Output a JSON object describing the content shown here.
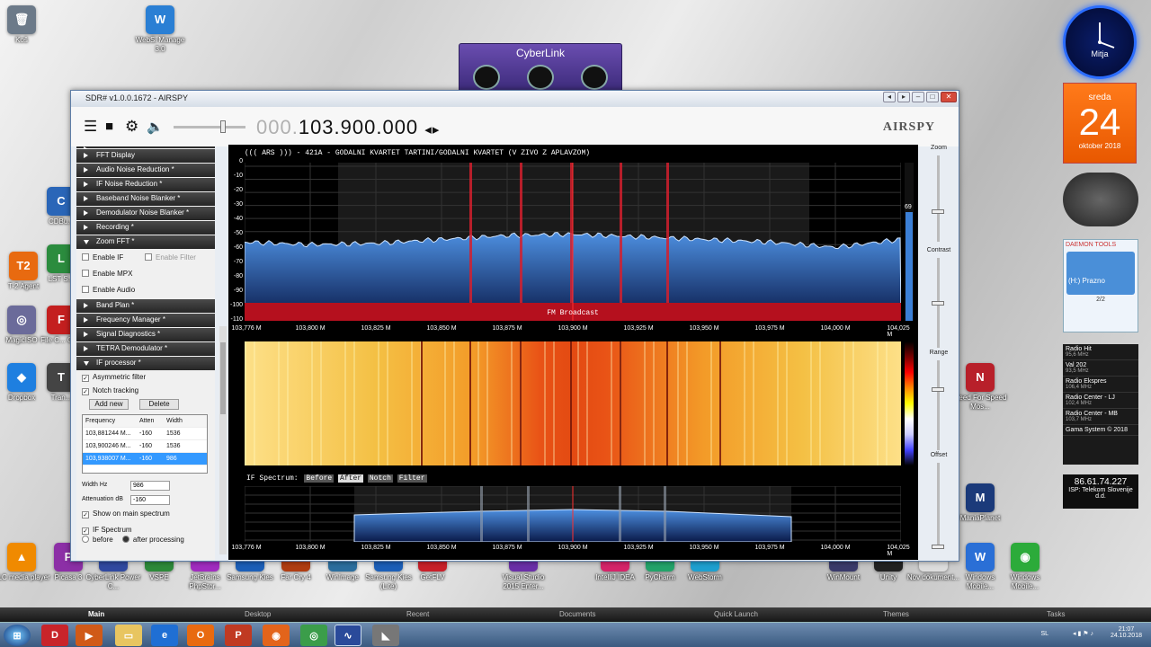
{
  "desktop": {
    "icons_left": [
      {
        "label": "Koš",
        "color": "#6c7a89",
        "glyph": "🗑"
      },
      {
        "label": "WebSi Manage 3.0",
        "color": "#2a7fd4",
        "glyph": "W"
      },
      {
        "label": "CDBu...",
        "color": "#2a66b8",
        "glyph": "C"
      },
      {
        "label": "T-2 Agent",
        "color": "#e86a10",
        "glyph": "T2"
      },
      {
        "label": "LST S...",
        "color": "#2b8c3e",
        "glyph": "L"
      },
      {
        "label": "MagicISO",
        "color": "#6b6b9a",
        "glyph": "◎"
      },
      {
        "label": "File C... Cli...",
        "color": "#c41f1f",
        "glyph": "F"
      },
      {
        "label": "Dropbox",
        "color": "#1e7fe0",
        "glyph": "◆"
      },
      {
        "label": "Tran...",
        "color": "#444",
        "glyph": "T"
      }
    ],
    "icons_bottom": [
      {
        "label": "VLC media player",
        "color": "#f08a00",
        "glyph": "▲"
      },
      {
        "label": "Picasa 3",
        "color": "#8c2fa6",
        "glyph": "P"
      },
      {
        "label": "CyberLink Power C...",
        "color": "#3049a0",
        "glyph": "C"
      },
      {
        "label": "VSPE",
        "color": "#2d8a3a",
        "glyph": "V"
      },
      {
        "label": "JetBrains PhpStor...",
        "color": "#a12cc0",
        "glyph": "J"
      },
      {
        "label": "Samsung Kies",
        "color": "#1c5fb8",
        "glyph": "S"
      },
      {
        "label": "Far Cry 4",
        "color": "#b03d12",
        "glyph": "F"
      },
      {
        "label": "WinImage",
        "color": "#2c6e9e",
        "glyph": "W"
      },
      {
        "label": "Samsung Kies (Lite)",
        "color": "#1c5fb8",
        "glyph": "S"
      },
      {
        "label": "GetFLV",
        "color": "#c9202a",
        "glyph": "G"
      },
      {
        "label": "Visual Studio 2015 Enter...",
        "color": "#6a2fa8",
        "glyph": "V"
      },
      {
        "label": "IntelliJ IDEA",
        "color": "#d6246a",
        "glyph": "I"
      },
      {
        "label": "PyCharm",
        "color": "#23a36a",
        "glyph": "P"
      },
      {
        "label": "WebStorm",
        "color": "#1ea0d0",
        "glyph": "W"
      },
      {
        "label": "WinMount",
        "color": "#3a3a6a",
        "glyph": "W"
      },
      {
        "label": "Unity",
        "color": "#222",
        "glyph": "U"
      },
      {
        "label": "Nov dokument...",
        "color": "#ddd",
        "glyph": "D"
      },
      {
        "label": "Windows Mobile...",
        "color": "#2a6fd6",
        "glyph": "W"
      },
      {
        "label": "Windows Mobile...",
        "color": "#2cab3a",
        "glyph": "◉"
      }
    ],
    "icons_right": [
      {
        "label": "Need For Speed Mos...",
        "color": "#b8202a",
        "glyph": "N"
      },
      {
        "label": "ManiaPlanet",
        "color": "#1b3a7a",
        "glyph": "M"
      }
    ],
    "cyberlink_title": "CyberLink",
    "clock_name": "Mitja",
    "calendar": {
      "day": "sreda",
      "date": "24",
      "month": "oktober 2018"
    },
    "daemon": {
      "brand": "DAEMON TOOLS",
      "drive": "(H:) Prazno",
      "count": "2/2"
    },
    "radio": [
      {
        "name": "Radio Hit",
        "freq": "95,6 MHz"
      },
      {
        "name": "Val 202",
        "freq": "93,5 MHz"
      },
      {
        "name": "Radio Ekspres",
        "freq": "106,4 MHz"
      },
      {
        "name": "Radio Center - LJ",
        "freq": "102,4 MHz"
      },
      {
        "name": "Radio Center - MB",
        "freq": "103,7 MHz"
      },
      {
        "name": "Gama System © 2018",
        "freq": ""
      }
    ],
    "ip": {
      "address": "86.61.74.227",
      "isp": "ISP: Telekom Slovenije d.d."
    }
  },
  "window": {
    "title": "SDR# v1.0.0.1672 - AIRSPY",
    "frequency_dim": "000.",
    "frequency": "103.900.000",
    "logo": "AIRSPY",
    "left_panel": {
      "sections_top": [
        "FFT Display",
        "Audio Noise Reduction *",
        "IF Noise Reduction *",
        "Baseband Noise Blanker *",
        "Demodulator Noise Blanker *",
        "Recording *",
        "Zoom FFT *"
      ],
      "enable_if": "Enable IF",
      "enable_filter": "Enable Filter",
      "enable_mpx": "Enable MPX",
      "enable_audio": "Enable Audio",
      "sections_mid": [
        "Band Plan *",
        "Frequency Manager *",
        "Signal Diagnostics *",
        "TETRA Demodulator *",
        "IF processor *"
      ],
      "asymmetric_filter": "Asymmetric filter",
      "notch_tracking": "Notch tracking",
      "add_new": "Add new",
      "delete": "Delete",
      "table": {
        "headers": [
          "Frequency",
          "Atten",
          "Width"
        ],
        "rows": [
          [
            "103,881244 M...",
            "-160",
            "1536"
          ],
          [
            "103,900246 M...",
            "-160",
            "1536"
          ],
          [
            "103,938007 M...",
            "-160",
            "986"
          ]
        ]
      },
      "width_label": "Width Hz",
      "width_value": "986",
      "atten_label": "Attenuation dB",
      "atten_value": "-160",
      "show_main": "Show on main spectrum",
      "if_spectrum": "IF Spectrum",
      "before": "before",
      "after_processing": "after processing"
    },
    "marquee": "(((    ARS    ))) - 421A - GODALNI KVARTET TARTINI/GODALNI KVARTET (V ZIVO Z APLAVZOM)",
    "band_label": "FM Broadcast",
    "y_ticks": [
      "0",
      "-10",
      "-20",
      "-30",
      "-40",
      "-50",
      "-60",
      "-70",
      "-80",
      "-90",
      "-100",
      "-110"
    ],
    "x_ticks": [
      "103,776 M",
      "103,800 M",
      "103,825 M",
      "103,850 M",
      "103,875 M",
      "103,900 M",
      "103,925 M",
      "103,950 M",
      "103,975 M",
      "104,000 M",
      "104,025 M"
    ],
    "level_value": "69",
    "if_label": "IF Spectrum:",
    "if_buttons": [
      "Before",
      "After",
      "Notch",
      "Filter"
    ],
    "controls": [
      "Zoom",
      "Contrast",
      "Range",
      "Offset"
    ]
  },
  "dock": [
    "Main",
    "Desktop",
    "Recent",
    "Documents",
    "Quick Launch",
    "Themes",
    "Tasks"
  ],
  "tray": {
    "lang": "SL",
    "time": "21:07",
    "date": "24.10.2018"
  },
  "chart_data": {
    "type": "line",
    "title": "",
    "xlabel": "",
    "ylabel": "",
    "ylim": [
      -110,
      0
    ],
    "x": [
      "103,776 M",
      "103,800 M",
      "103,825 M",
      "103,850 M",
      "103,875 M",
      "103,900 M",
      "103,925 M",
      "103,950 M",
      "103,975 M",
      "104,000 M",
      "104,025 M"
    ],
    "series": [
      {
        "values": [
          -58,
          -60,
          -59,
          -56,
          -53,
          -52,
          -54,
          -56,
          -58,
          -62,
          -56
        ]
      }
    ],
    "notches_mhz": [
      103.881244,
      103.900246,
      103.938007
    ]
  }
}
